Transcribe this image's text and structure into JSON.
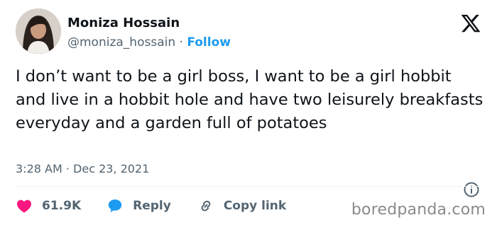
{
  "author": {
    "display_name": "Moniza Hossain",
    "handle": "@moniza_hossain",
    "separator": "·",
    "follow_label": "Follow"
  },
  "tweet": {
    "text": "I don’t want to be a girl boss, I want to be a girl hobbit and live in a hobbit hole and have two leisurely breakfasts everyday and a garden full of potatoes",
    "timestamp": "3:28 AM · Dec 23, 2021"
  },
  "actions": {
    "likes": "61.9K",
    "reply_label": "Reply",
    "copy_link_label": "Copy link"
  },
  "watermark": "boredpanda.com",
  "icons": {
    "logo": "x-logo-icon",
    "info": "info-icon",
    "like": "heart-icon",
    "reply": "reply-bubble-icon",
    "copy": "link-icon"
  },
  "colors": {
    "like": "#f91880",
    "reply": "#1d9bf0",
    "follow": "#1d9bf0",
    "secondary_text": "#536471"
  }
}
